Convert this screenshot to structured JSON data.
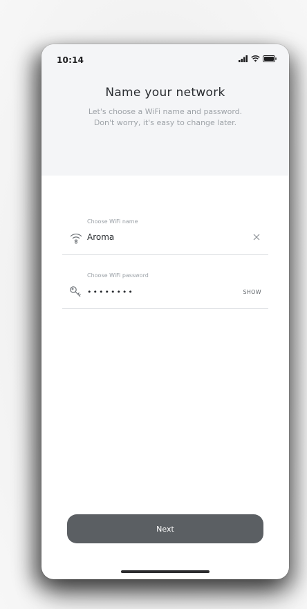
{
  "status_bar": {
    "time": "10:14",
    "icons": [
      "signal-icon",
      "wifi-icon",
      "battery-icon"
    ]
  },
  "header": {
    "title": "Name your network",
    "subtitle_line1": "Let's choose a WiFi name and password.",
    "subtitle_line2": "Don't worry, it's easy to change later."
  },
  "wifi_name": {
    "label": "Choose WiFi name",
    "value": "Aroma",
    "icon": "wifi-icon",
    "clear_icon": "close-icon"
  },
  "wifi_password": {
    "label": "Choose WiFi password",
    "value": "••••••••",
    "icon": "key-icon",
    "show_label": "SHOW"
  },
  "actions": {
    "next_label": "Next"
  },
  "colors": {
    "header_bg": "#f4f5f7",
    "button_bg": "#5b5f63",
    "text_primary": "#2a2d31",
    "text_secondary": "#9ea3a8"
  }
}
